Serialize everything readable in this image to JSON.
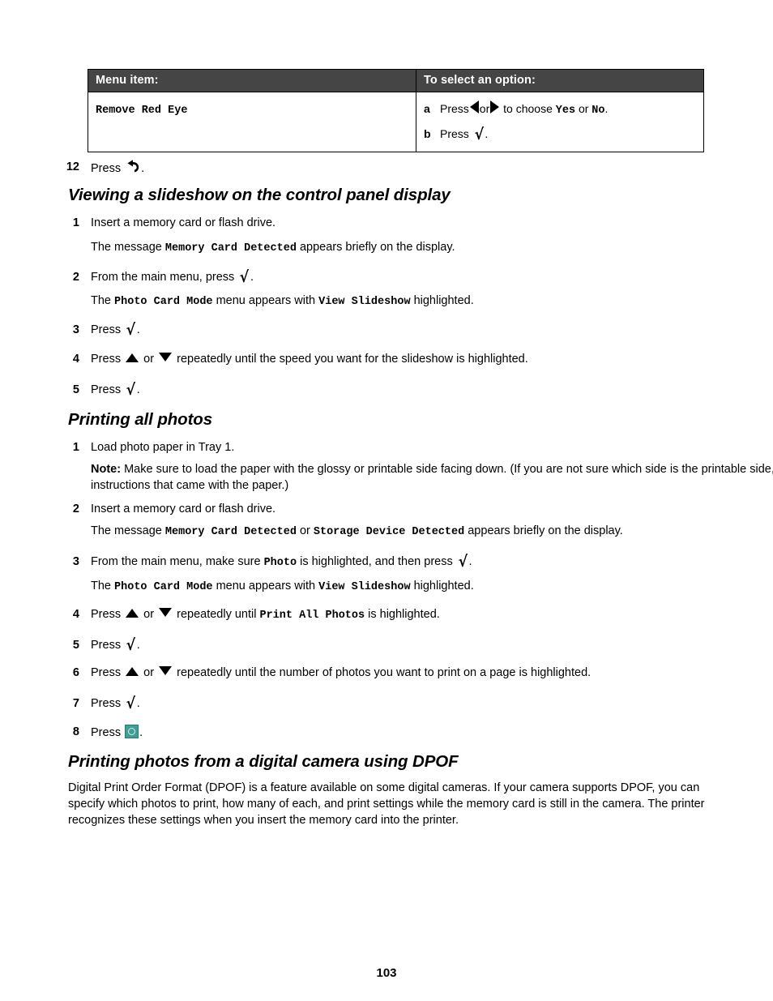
{
  "table": {
    "headers": [
      "Menu item:",
      "To select an option:"
    ],
    "row": {
      "menu_item": "Remove Red Eye",
      "options": [
        {
          "label": "a",
          "pre": "Press",
          "mid": "or",
          "post": "to choose",
          "choice1": "Yes",
          "or": "or",
          "choice2": "No",
          "end": "."
        },
        {
          "label": "b",
          "pre": "Press",
          "end": "."
        }
      ]
    }
  },
  "step12": {
    "num": "12",
    "pre": "Press",
    "end": "."
  },
  "sections": [
    {
      "heading": "Viewing a slideshow on the control panel display",
      "steps": [
        {
          "num": "1",
          "text": "Insert a memory card or flash drive."
        },
        {
          "num": "2",
          "pre": "From the main menu, press",
          "end": "."
        },
        {
          "num": "3",
          "pre": "Press",
          "end": "."
        },
        {
          "num": "4",
          "pre": "Press",
          "mid": "or",
          "post": "repeatedly until the speed you want for the slideshow is highlighted."
        },
        {
          "num": "5",
          "pre": "Press",
          "end": "."
        }
      ],
      "paras": {
        "p1_a": "The message ",
        "p1_mono": "Memory Card Detected",
        "p1_b": " appears briefly on the display.",
        "p2_a": "The ",
        "p2_mono1": "Photo Card Mode",
        "p2_b": " menu appears with ",
        "p2_mono2": "View Slideshow",
        "p2_c": " highlighted."
      }
    },
    {
      "heading": "Printing all photos",
      "steps": [
        {
          "num": "1",
          "text": "Load photo paper in Tray 1."
        },
        {
          "num": "2",
          "text": "Insert a memory card or flash drive."
        },
        {
          "num": "3",
          "pre": "From the main menu, make sure",
          "mono": "Photo",
          "post": "is highlighted, and then press",
          "end": "."
        },
        {
          "num": "4",
          "pre": "Press",
          "mid": "or",
          "post": "repeatedly until",
          "mono": "Print All Photos",
          "tail": "is highlighted."
        },
        {
          "num": "5",
          "pre": "Press",
          "end": "."
        },
        {
          "num": "6",
          "pre": "Press",
          "mid": "or",
          "post": "repeatedly until the number of photos you want to print on a page is highlighted."
        },
        {
          "num": "7",
          "pre": "Press",
          "end": "."
        },
        {
          "num": "8",
          "pre": "Press",
          "end": "."
        }
      ],
      "note": {
        "label": "Note:",
        "text": " Make sure to load the paper with the glossy or printable side facing down. (If you are not sure which side is the printable side, see the instructions that came with the paper.)"
      },
      "paras": {
        "p_msg_a": "The message ",
        "p_msg_mono1": "Memory Card Detected",
        "p_msg_or": " or ",
        "p_msg_mono2": "Storage Device Detected",
        "p_msg_b": " appears briefly on the display.",
        "p_mode_a": "The ",
        "p_mode_mono1": "Photo Card Mode",
        "p_mode_b": " menu appears with ",
        "p_mode_mono2": "View Slideshow",
        "p_mode_c": " highlighted."
      }
    },
    {
      "heading": "Printing photos from a digital camera using DPOF",
      "body": "Digital Print Order Format (DPOF) is a feature available on some digital cameras. If your camera supports DPOF, you can specify which photos to print, how many of each, and print settings while the memory card is still in the camera. The printer recognizes these settings when you insert the memory card into the printer."
    }
  ],
  "footer": {
    "page_number": "103"
  },
  "colors": {
    "table_header_bg": "#454545",
    "table_header_text": "#ffffff",
    "start_button": "#3f9e96",
    "text": "#000000"
  }
}
